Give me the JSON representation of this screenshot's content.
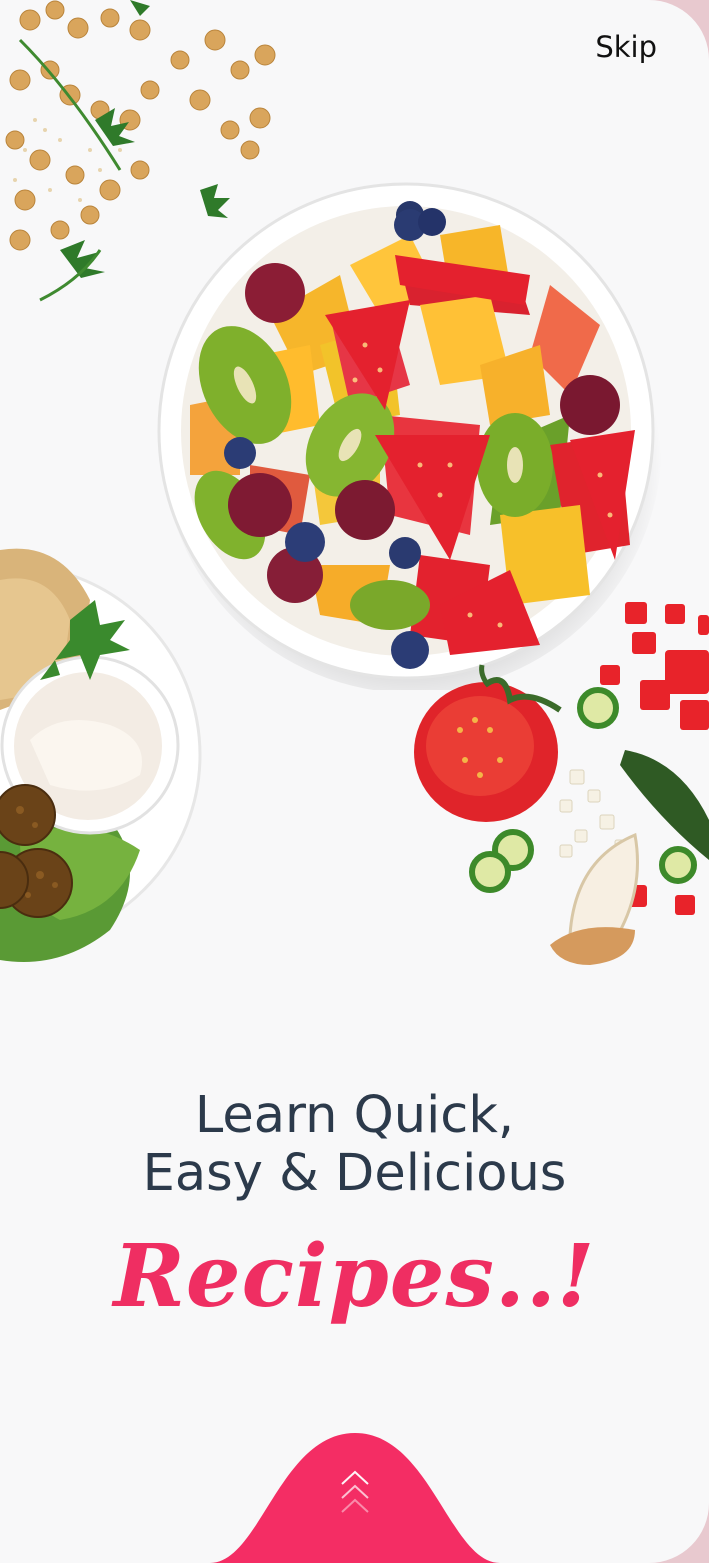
{
  "app": {
    "skip_label": "Skip",
    "headline_line1": "Learn Quick,",
    "headline_line2": "Easy & Delicious",
    "accent_word": "Recipes..!"
  },
  "icons": {
    "next": "chevron-up-icon"
  },
  "colors": {
    "accent": "#ef2e62",
    "headline": "#2c3a4b",
    "background": "#f8f8f9",
    "frame": "#e8c9cf"
  }
}
